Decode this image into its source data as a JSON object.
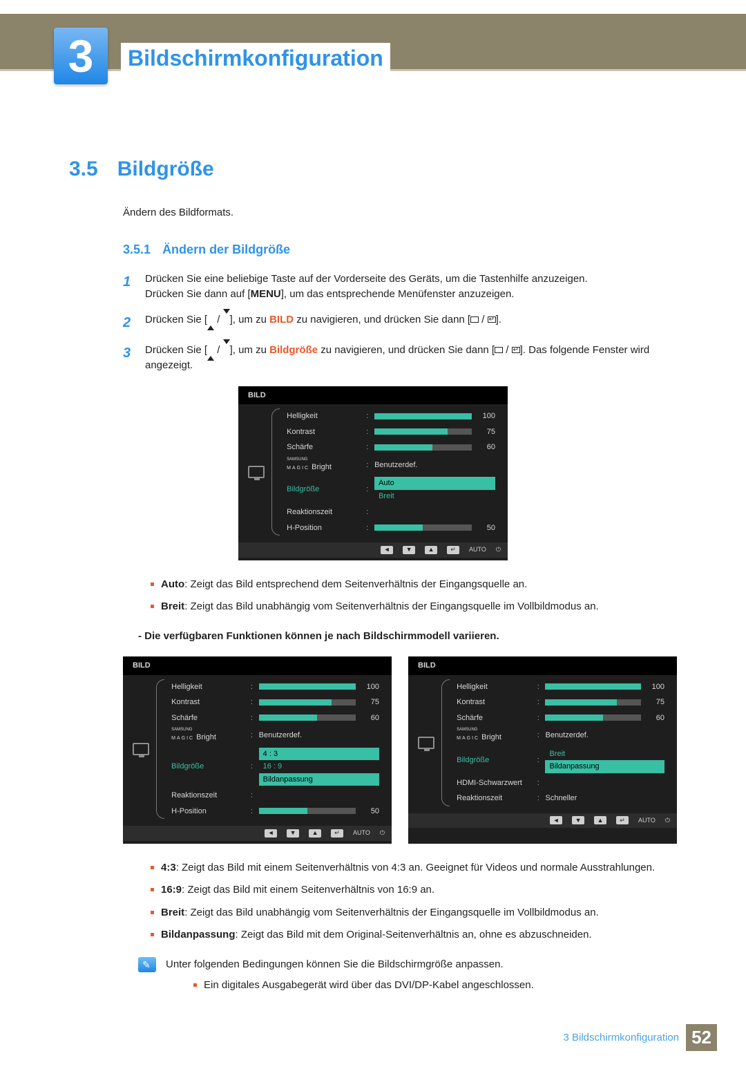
{
  "chapter": {
    "number": "3",
    "title": "Bildschirmkonfiguration"
  },
  "section": {
    "number": "3.5",
    "title": "Bildgröße",
    "intro": "Ändern des Bildformats."
  },
  "subsection": {
    "number": "3.5.1",
    "title": "Ändern der Bildgröße"
  },
  "steps": {
    "s1a": "Drücken Sie eine beliebige Taste auf der Vorderseite des Geräts, um die Tastenhilfe anzuzeigen.",
    "s1b_pre": "Drücken Sie dann auf [",
    "s1b_menu": "MENU",
    "s1b_post": "], um das entsprechende Menüfenster anzuzeigen.",
    "s2_pre": "Drücken Sie [",
    "s2_mid": "], um zu ",
    "s2_target": "BILD",
    "s2_post1": " zu navigieren, und drücken Sie dann [",
    "s2_post2": "].",
    "s3_pre": "Drücken Sie [",
    "s3_mid": "], um zu ",
    "s3_target": "Bildgröße",
    "s3_post1": " zu navigieren, und drücken Sie dann [",
    "s3_post2": "]. Das folgende Fenster wird angezeigt."
  },
  "osd_common": {
    "title": "BILD",
    "items": {
      "brightness": {
        "label": "Helligkeit",
        "value": 100
      },
      "contrast": {
        "label": "Kontrast",
        "value": 75
      },
      "sharpness": {
        "label": "Schärfe",
        "value": 60
      },
      "magic": {
        "label_top": "SAMSUNG",
        "label_main": "MAGIC",
        "label_suffix": " Bright",
        "value": "Benutzerdef."
      },
      "picsize": {
        "label": "Bildgröße"
      },
      "response": {
        "label": "Reaktionszeit"
      },
      "hpos": {
        "label": "H-Position",
        "value": 50
      },
      "hdmi_black": {
        "label": "HDMI-Schwarzwert"
      },
      "fast": {
        "value": "Schneller"
      }
    },
    "footer_auto": "AUTO"
  },
  "osd1_options": [
    "Auto",
    "Breit"
  ],
  "osd2_options": [
    "4 : 3",
    "16 : 9",
    "Bildanpassung"
  ],
  "osd3_options": [
    "Breit",
    "Bildanpassung"
  ],
  "bullets1": {
    "auto_t": "Auto",
    "auto": ": Zeigt das Bild entsprechend dem Seitenverhältnis der Eingangsquelle an.",
    "breit_t": "Breit",
    "breit": ": Zeigt das Bild unabhängig vom Seitenverhältnis der Eingangsquelle im Vollbildmodus an."
  },
  "note1": "- Die verfügbaren Funktionen können je nach Bildschirmmodell variieren.",
  "bullets2": {
    "r43_t": "4:3",
    "r43": ": Zeigt das Bild mit einem Seitenverhältnis von 4:3 an. Geeignet für Videos und normale Ausstrahlungen.",
    "r169_t": "16:9",
    "r169": ": Zeigt das Bild mit einem Seitenverhältnis von 16:9 an.",
    "breit_t": "Breit",
    "breit": ": Zeigt das Bild unabhängig vom Seitenverhältnis der Eingangsquelle im Vollbildmodus an.",
    "fit_t": "Bildanpassung",
    "fit": ": Zeigt das Bild mit dem Original-Seitenverhältnis an, ohne es abzuschneiden."
  },
  "info_text": "Unter folgenden Bedingungen können Sie die Bildschirmgröße anpassen.",
  "info_bullet": "Ein digitales Ausgabegerät wird über das DVI/DP-Kabel angeschlossen.",
  "footer": {
    "label": "3 Bildschirmkonfiguration",
    "page": "52"
  }
}
